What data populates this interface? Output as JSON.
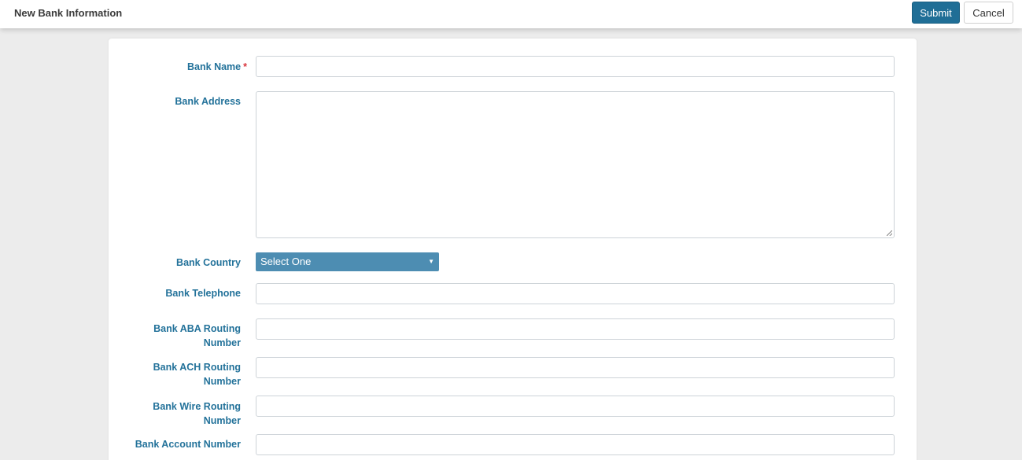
{
  "header": {
    "title": "New Bank Information",
    "submit_label": "Submit",
    "cancel_label": "Cancel"
  },
  "form": {
    "bank_name": {
      "label": "Bank Name",
      "required_mark": "*",
      "value": ""
    },
    "bank_address": {
      "label": "Bank Address",
      "value": ""
    },
    "bank_country": {
      "label": "Bank Country",
      "selected": "Select One"
    },
    "bank_telephone": {
      "label": "Bank Telephone",
      "value": ""
    },
    "bank_aba": {
      "label_line1": "Bank ABA Routing",
      "label_line2": "Number",
      "value": ""
    },
    "bank_ach": {
      "label_line1": "Bank ACH Routing",
      "label_line2": "Number",
      "value": ""
    },
    "bank_wire": {
      "label_line1": "Bank Wire Routing",
      "label_line2": "Number",
      "value": ""
    },
    "bank_account": {
      "label": "Bank Account Number",
      "value": ""
    }
  },
  "icons": {
    "dropdown": "caret-down-icon",
    "resize": "resize-grip-icon"
  },
  "colors": {
    "accent": "#1f6e96",
    "label": "#23729a",
    "select_bg": "#4d8db2",
    "required": "#d9363e"
  }
}
